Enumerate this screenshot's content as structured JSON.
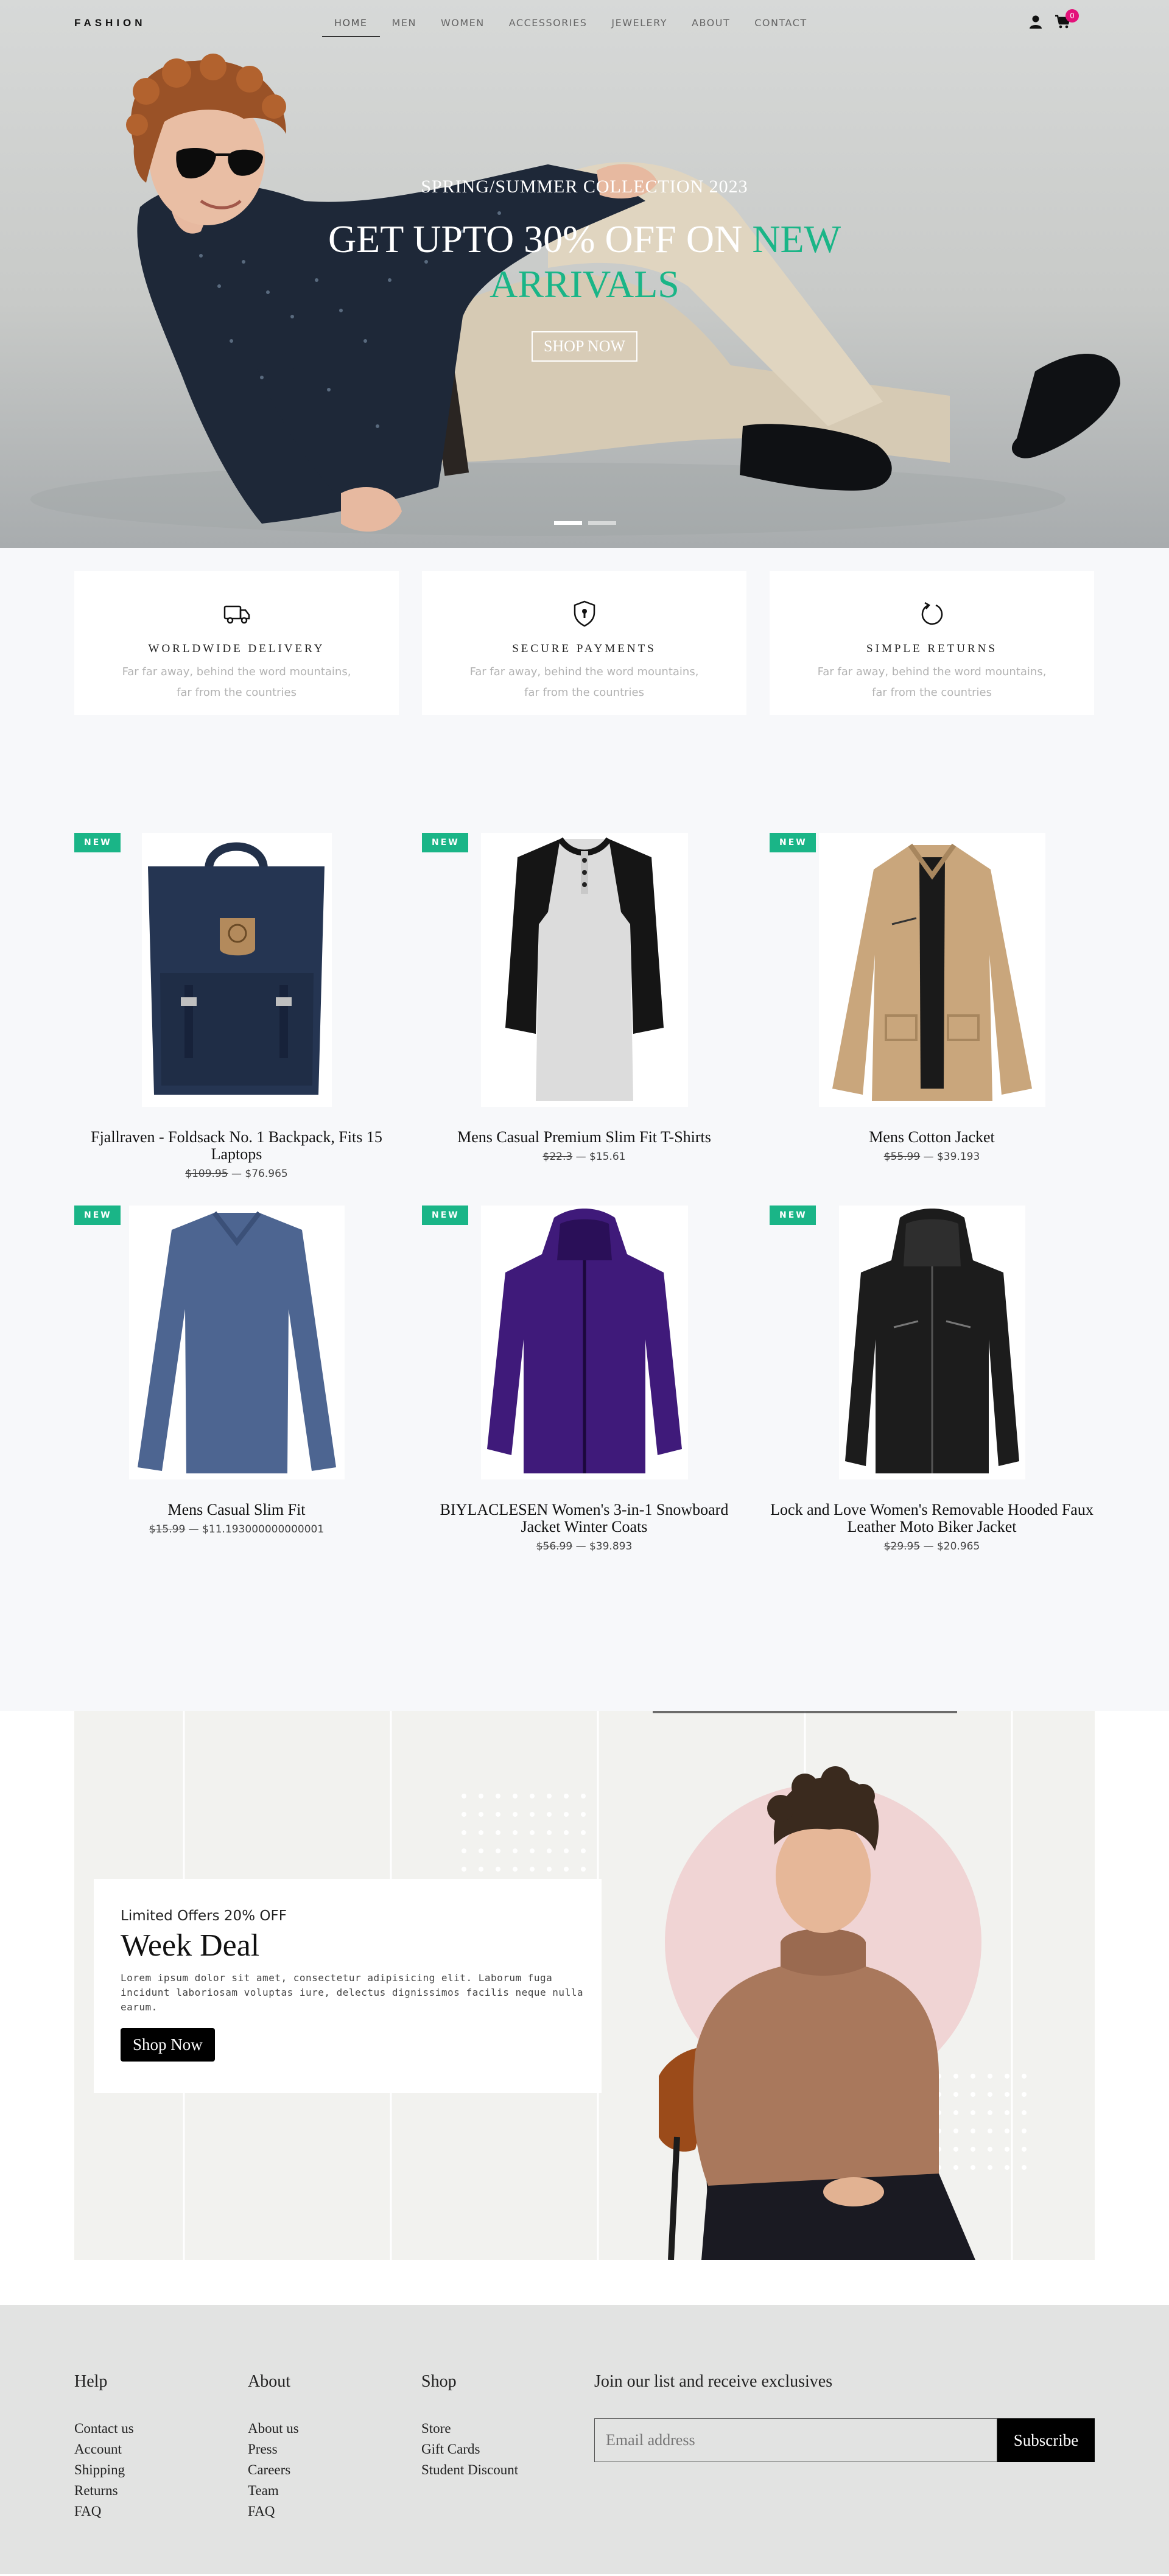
{
  "nav": {
    "logo": "FASHION",
    "items": [
      "HOME",
      "MEN",
      "WOMEN",
      "ACCESSORIES",
      "JEWELERY",
      "ABOUT",
      "CONTACT"
    ],
    "active": "HOME",
    "cart_count": "0",
    "icons": [
      "user-icon",
      "cart-icon"
    ]
  },
  "hero": {
    "subtitle": "SPRING/SUMMER COLLECTION 2023",
    "title_main": "GET UPTO 30% OFF ON ",
    "title_accent_1": "NEW",
    "title_accent_2": "ARRIVALS",
    "button": "SHOP NOW",
    "accent_color": "#1ab587"
  },
  "features": [
    {
      "icon": "truck-icon",
      "title": "WORLDWIDE DELIVERY",
      "line1": "Far far away, behind the word mountains,",
      "line2": "far from the countries"
    },
    {
      "icon": "shield-icon",
      "title": "SECURE PAYMENTS",
      "line1": "Far far away, behind the word mountains,",
      "line2": "far from the countries"
    },
    {
      "icon": "return-icon",
      "title": "SIMPLE RETURNS",
      "line1": "Far far away, behind the word mountains,",
      "line2": "far from the countries"
    }
  ],
  "products": [
    {
      "badge": "NEW",
      "name": "Fjallraven - Foldsack No. 1 Backpack, Fits 15 Laptops",
      "old_price": "$109.95",
      "sep": " — ",
      "price": "$76.965"
    },
    {
      "badge": "NEW",
      "name": "Mens Casual Premium Slim Fit T-Shirts",
      "old_price": "$22.3",
      "sep": " — ",
      "price": "$15.61"
    },
    {
      "badge": "NEW",
      "name": "Mens Cotton Jacket",
      "old_price": "$55.99",
      "sep": " — ",
      "price": "$39.193"
    },
    {
      "badge": "NEW",
      "name": "Mens Casual Slim Fit",
      "old_price": "$15.99",
      "sep": " — ",
      "price": "$11.193000000000001"
    },
    {
      "badge": "NEW",
      "name": "BIYLACLESEN Women's 3-in-1 Snowboard Jacket Winter Coats",
      "old_price": "$56.99",
      "sep": " — ",
      "price": "$39.893"
    },
    {
      "badge": "NEW",
      "name": "Lock and Love Women's Removable Hooded Faux Leather Moto Biker Jacket",
      "old_price": "$29.95",
      "sep": " — ",
      "price": "$20.965"
    }
  ],
  "deal": {
    "kicker": "Limited Offers 20% OFF",
    "title": "Week Deal",
    "text": "Lorem ipsum dolor sit amet, consectetur adipisicing elit. Laborum fuga incidunt laboriosam voluptas iure, delectus dignissimos facilis neque nulla earum.",
    "button": "Shop Now"
  },
  "footer": {
    "columns": [
      {
        "title": "Help",
        "links": [
          "Contact us",
          "Account",
          "Shipping",
          "Returns",
          "FAQ"
        ]
      },
      {
        "title": "About",
        "links": [
          "About us",
          "Press",
          "Careers",
          "Team",
          "FAQ"
        ]
      },
      {
        "title": "Shop",
        "links": [
          "Store",
          "Gift Cards",
          "Student Discount"
        ]
      }
    ],
    "newsletter_title": "Join our list and receive exclusives",
    "email_placeholder": "Email address",
    "subscribe": "Subscribe"
  }
}
